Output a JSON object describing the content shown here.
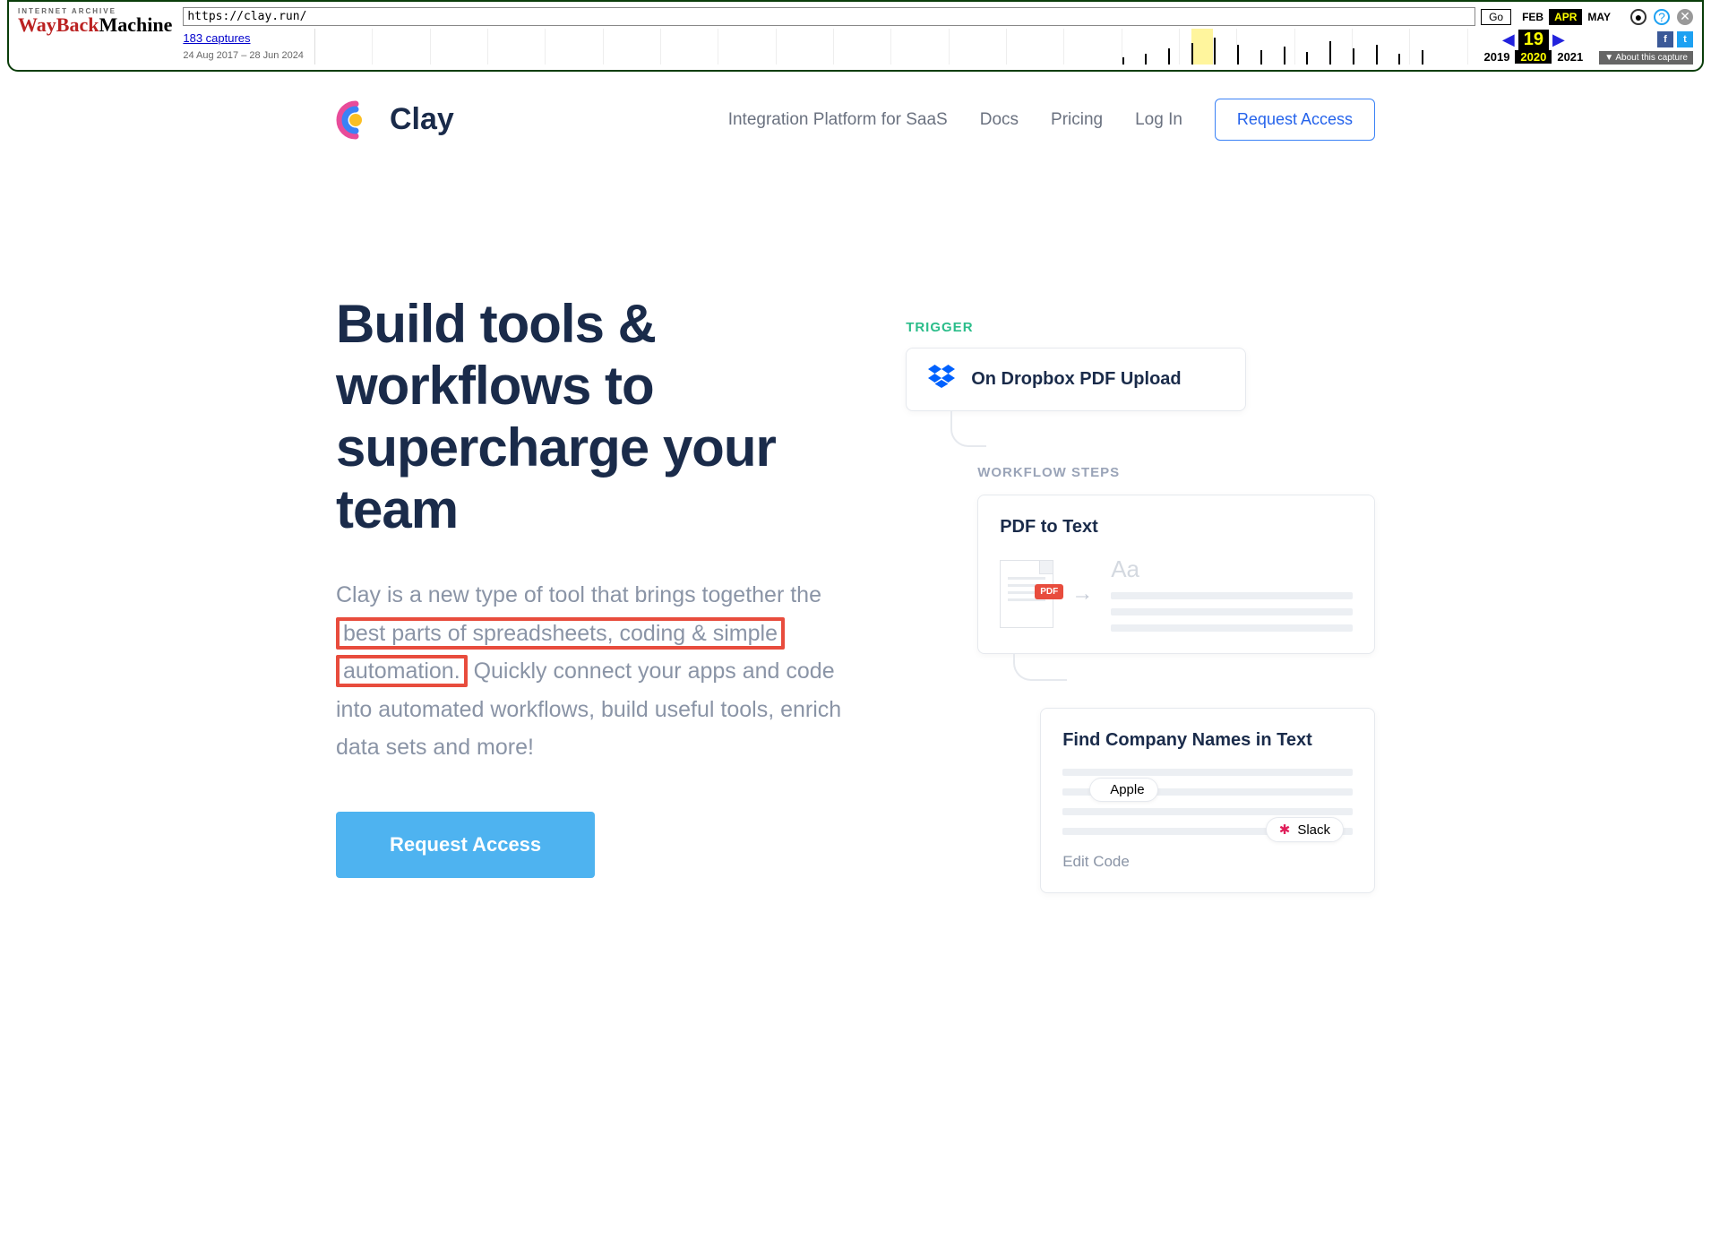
{
  "wayback": {
    "archive_label": "INTERNET ARCHIVE",
    "logo_red": "WayBack",
    "logo_black": "Machine",
    "url": "https://clay.run/",
    "go": "Go",
    "captures": "183 captures",
    "date_range": "24 Aug 2017 – 28 Jun 2024",
    "months": {
      "prev": "FEB",
      "current": "APR",
      "next": "MAY"
    },
    "day": "19",
    "years": {
      "prev": "2019",
      "current": "2020",
      "next": "2021"
    },
    "about": "About this capture"
  },
  "nav": {
    "brand": "Clay",
    "links": {
      "integration": "Integration Platform for SaaS",
      "docs": "Docs",
      "pricing": "Pricing",
      "login": "Log In"
    },
    "cta": "Request Access"
  },
  "hero": {
    "title": "Build tools & workflows to supercharge your team",
    "desc_before": "Clay is a new type of tool that brings together the ",
    "desc_highlight": "best parts of spreadsheets, coding & simple automation.",
    "desc_after": " Quickly connect your apps and code into automated workflows, build useful tools, enrich data sets and more!",
    "cta": "Request Access"
  },
  "workflow": {
    "trigger_label": "TRIGGER",
    "trigger_text": "On Dropbox PDF Upload",
    "steps_label": "WORKFLOW STEPS",
    "step1_title": "PDF to Text",
    "pdf_badge": "PDF",
    "text_sample": "Aa",
    "step2_title": "Find Company Names in Text",
    "pill_apple": "Apple",
    "pill_slack": "Slack",
    "edit_code": "Edit Code"
  }
}
